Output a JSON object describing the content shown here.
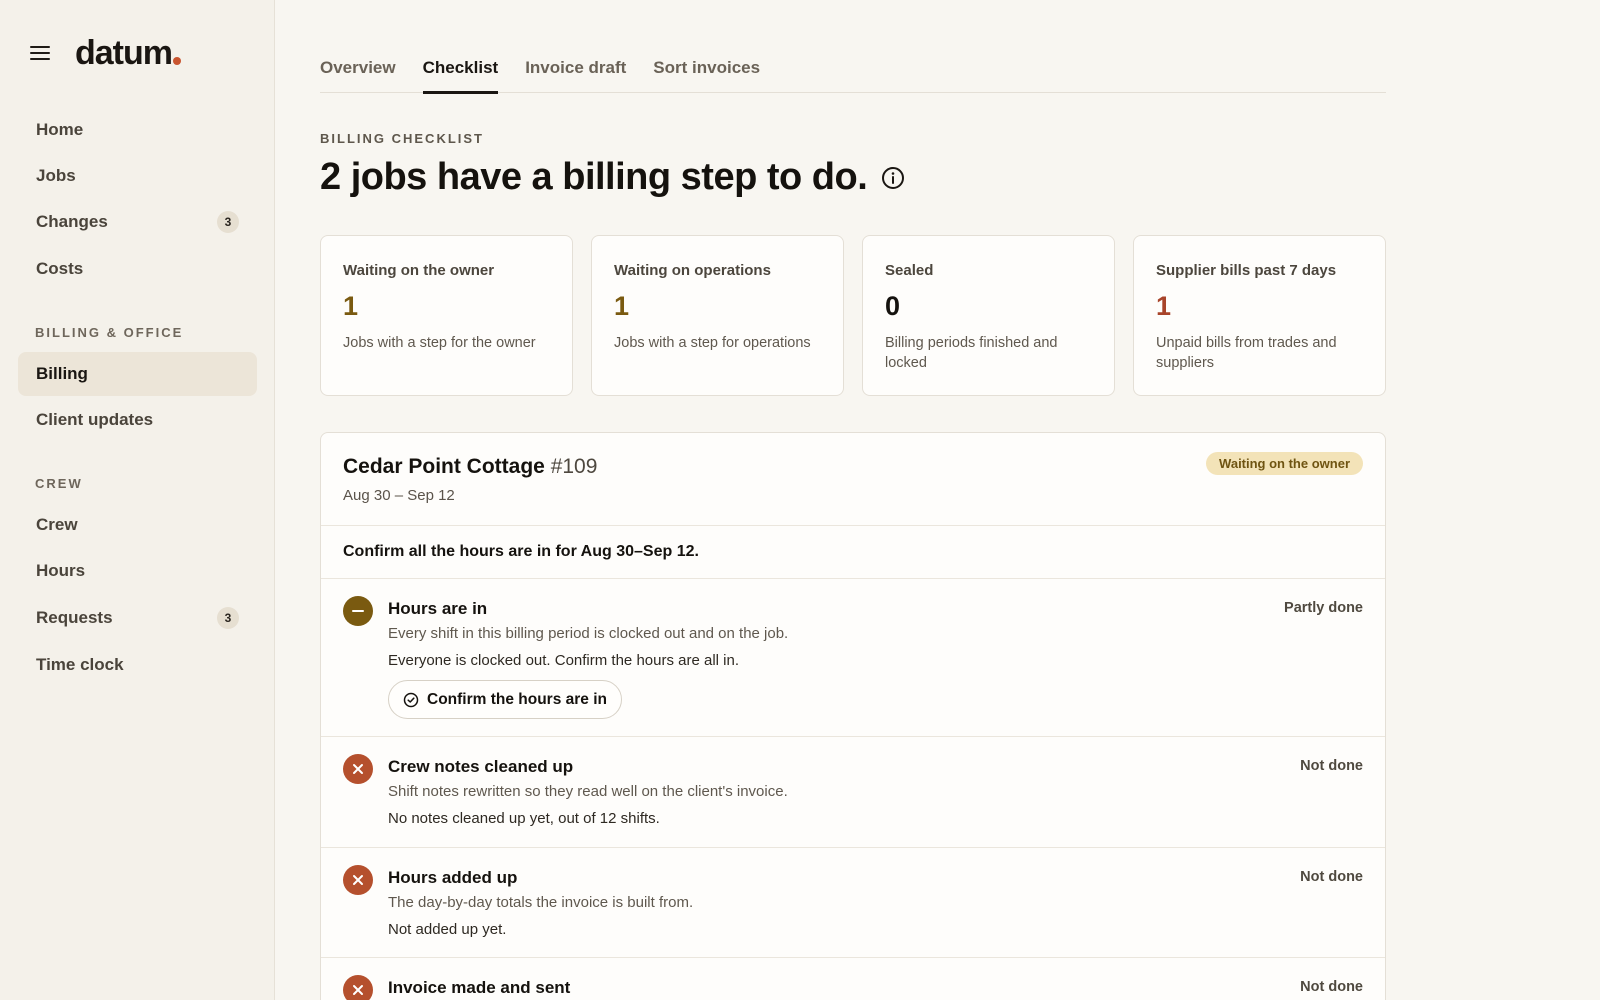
{
  "brand": {
    "name": "datum"
  },
  "sidebar": {
    "items_top": [
      {
        "label": "Home"
      },
      {
        "label": "Jobs"
      },
      {
        "label": "Changes",
        "badge": "3"
      },
      {
        "label": "Costs"
      }
    ],
    "section_billing": "BILLING & OFFICE",
    "items_billing": [
      {
        "label": "Billing",
        "active": true
      },
      {
        "label": "Client updates"
      }
    ],
    "section_crew": "CREW",
    "items_crew": [
      {
        "label": "Crew"
      },
      {
        "label": "Hours"
      },
      {
        "label": "Requests",
        "badge": "3"
      },
      {
        "label": "Time clock"
      }
    ]
  },
  "tabs": [
    {
      "label": "Overview"
    },
    {
      "label": "Checklist",
      "active": true
    },
    {
      "label": "Invoice draft"
    },
    {
      "label": "Sort invoices"
    }
  ],
  "header": {
    "eyebrow": "BILLING CHECKLIST",
    "title": "2 jobs have a billing step to do."
  },
  "stats": [
    {
      "label": "Waiting on the owner",
      "value": "1",
      "desc": "Jobs with a step for the owner",
      "color": "#7a5a10"
    },
    {
      "label": "Waiting on operations",
      "value": "1",
      "desc": "Jobs with a step for operations",
      "color": "#7a5a10"
    },
    {
      "label": "Sealed",
      "value": "0",
      "desc": "Billing periods finished and locked",
      "color": "#15120e"
    },
    {
      "label": "Supplier bills past 7 days",
      "value": "1",
      "desc": "Unpaid bills from trades and suppliers",
      "color": "#a8442a"
    }
  ],
  "job": {
    "name": "Cedar Point Cottage",
    "number": "#109",
    "dates": "Aug 30 – Sep 12",
    "status": "Waiting on the owner",
    "instruction": "Confirm all the hours are in for Aug 30–Sep 12.",
    "steps": [
      {
        "title": "Hours are in",
        "desc": "Every shift in this billing period is clocked out and on the job.",
        "note": "Everyone is clocked out. Confirm the hours are all in.",
        "status": "Partly done",
        "icon": "minus-icon",
        "action": "Confirm the hours are in"
      },
      {
        "title": "Crew notes cleaned up",
        "desc": "Shift notes rewritten so they read well on the client's invoice.",
        "note": "No notes cleaned up yet, out of 12 shifts.",
        "status": "Not done",
        "icon": "x-icon"
      },
      {
        "title": "Hours added up",
        "desc": "The day-by-day totals the invoice is built from.",
        "note": "Not added up yet.",
        "status": "Not done",
        "icon": "x-icon"
      },
      {
        "title": "Invoice made and sent",
        "status": "Not done",
        "icon": "x-icon"
      }
    ]
  }
}
